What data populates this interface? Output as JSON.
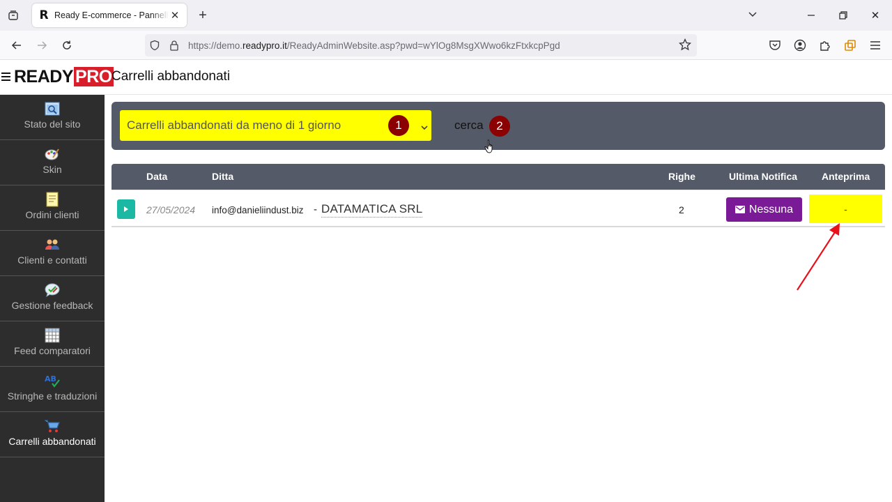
{
  "browser": {
    "tab_title": "Ready E-commerce - Pannello di controllo",
    "tab_favicon": "R",
    "url_prefix": "https://demo.",
    "url_domain": "readypro.it",
    "url_path": "/ReadyAdminWebsite.asp?pwd=wYlOg8MsgXWwo6kzFtxkcpPgd"
  },
  "header": {
    "logo_ready": "READY",
    "logo_pro": "PRO",
    "title": "Carrelli abbandonati"
  },
  "sidebar": {
    "items": [
      {
        "label": "Stato del sito",
        "icon": "site-status-icon"
      },
      {
        "label": "Skin",
        "icon": "palette-icon"
      },
      {
        "label": "Ordini clienti",
        "icon": "orders-icon"
      },
      {
        "label": "Clienti e contatti",
        "icon": "contacts-icon"
      },
      {
        "label": "Gestione feedback",
        "icon": "feedback-icon"
      },
      {
        "label": "Feed comparatori",
        "icon": "grid-icon"
      },
      {
        "label": "Stringhe e traduzioni",
        "icon": "translation-icon"
      },
      {
        "label": "Carrelli abbandonati",
        "icon": "cart-icon"
      }
    ],
    "active_index": 7
  },
  "filter": {
    "selected_period": "Carrelli abbandonati da meno di 1 giorno",
    "search_label": "cerca",
    "badge_1": "1",
    "badge_2": "2"
  },
  "table": {
    "headers": {
      "date": "Data",
      "company": "Ditta",
      "rows": "Righe",
      "last_notification": "Ultima Notifica",
      "preview": "Anteprima"
    },
    "rows": [
      {
        "date": "27/05/2024",
        "email": "info@danieliindust.biz",
        "separator": "-",
        "company": "DATAMATICA SRL",
        "row_count": "2",
        "notification": "Nessuna",
        "preview": "-"
      }
    ]
  },
  "colors": {
    "highlight": "#ffff00",
    "panel": "#545a67",
    "sidebar": "#2d2d2d",
    "badge": "#8b0000",
    "notify_button": "#7a1a96",
    "expand_button": "#1bb8a3",
    "logo_red": "#d81e2a",
    "annotation_arrow": "#e8101a"
  }
}
